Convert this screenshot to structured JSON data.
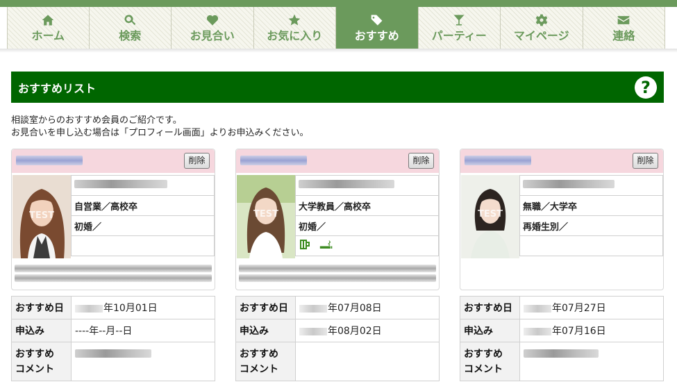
{
  "nav": {
    "items": [
      {
        "label": "ホーム",
        "icon": "home-icon"
      },
      {
        "label": "検索",
        "icon": "search-icon"
      },
      {
        "label": "お見合い",
        "icon": "heart-icon"
      },
      {
        "label": "お気に入り",
        "icon": "star-icon"
      },
      {
        "label": "おすすめ",
        "icon": "tags-icon"
      },
      {
        "label": "パーティー",
        "icon": "cocktail-icon"
      },
      {
        "label": "マイページ",
        "icon": "gear-icon"
      },
      {
        "label": "連絡",
        "icon": "mail-icon"
      }
    ],
    "active_index": 4,
    "accent_color": "#6b9a5c"
  },
  "section": {
    "title": "おすすめリスト",
    "help_label": "?",
    "header_color": "#006600"
  },
  "intro": {
    "line1": "相談室からのおすすめ会員のご紹介です。",
    "line2": "お見合いを申し込む場合は「プロフィール画面」よりお申込みください。"
  },
  "cards": [
    {
      "delete_label": "削除",
      "job_edu": "自営業／高校卒",
      "marital": "初婚／",
      "photo_watermark": "TEST",
      "icons": []
    },
    {
      "delete_label": "削除",
      "job_edu": "大学教員／高校卒",
      "marital": "初婚／",
      "photo_watermark": "TEST",
      "icons": [
        "beer-mug-icon",
        "smoking-icon"
      ]
    },
    {
      "delete_label": "削除",
      "job_edu": "無職／大学卒",
      "marital": "再婚生別／",
      "photo_watermark": "TEST",
      "icons": []
    }
  ],
  "details": {
    "labels": {
      "recommend_date": "おすすめ日",
      "apply": "申込み",
      "comment_line1": "おすすめ",
      "comment_line2": "コメント"
    },
    "rows": [
      {
        "recommend_date": "年10月01日",
        "apply": "----年--月--日"
      },
      {
        "recommend_date": "年07月08日",
        "apply": "年08月02日"
      },
      {
        "recommend_date": "年07月27日",
        "apply": "年07月16日"
      }
    ]
  }
}
